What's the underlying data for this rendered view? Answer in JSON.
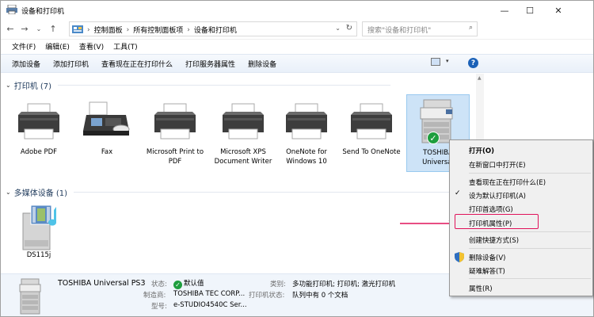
{
  "window": {
    "title": "设备和打印机",
    "minimize": "—",
    "maximize": "☐",
    "close": "✕"
  },
  "nav": {
    "back": "←",
    "forward": "→",
    "recent": "⌄",
    "up": "↑"
  },
  "address": {
    "crumbs": [
      "控制面板",
      "所有控制面板项",
      "设备和打印机"
    ],
    "separator": "›",
    "dropdown": "⌄",
    "refresh": "↻"
  },
  "search": {
    "placeholder": "搜索\"设备和打印机\"",
    "icon": "⌕"
  },
  "menu": [
    "文件(F)",
    "编辑(E)",
    "查看(V)",
    "工具(T)"
  ],
  "toolbar": {
    "commands": [
      "添加设备",
      "添加打印机",
      "查看现在正在打印什么",
      "打印服务器属性",
      "删除设备"
    ],
    "view_dropdown": "▾",
    "help": "?"
  },
  "groups": {
    "printers": {
      "title": "打印机 (7)",
      "chevron": "⌄"
    },
    "multimedia": {
      "title": "多媒体设备 (1)",
      "chevron": "⌄"
    }
  },
  "devices": {
    "printers": [
      {
        "name": "Adobe PDF"
      },
      {
        "name": "Fax"
      },
      {
        "name": "Microsoft Print to PDF"
      },
      {
        "name": "Microsoft XPS Document Writer"
      },
      {
        "name": "OneNote for Windows 10"
      },
      {
        "name": "Send To OneNote"
      },
      {
        "name": "TOSHIBA Universal"
      }
    ],
    "multimedia": [
      {
        "name": "DS115j"
      }
    ]
  },
  "details": {
    "name": "TOSHIBA Universal PS3",
    "status_label": "状态:",
    "status_value": "默认值",
    "manufacturer_label": "制造商:",
    "manufacturer_value": "TOSHIBA TEC CORP...",
    "model_label": "型号:",
    "model_value": "e-STUDIO4540C Ser...",
    "category_label": "类别:",
    "category_value": "多功能打印机; 打印机; 激光打印机",
    "printstatus_label": "打印机状态:",
    "printstatus_value": "队列中有 0 个文档"
  },
  "context_menu": {
    "open": "打开(O)",
    "open_new": "在新窗口中打开(E)",
    "see_printing": "查看现在正在打印什么(E)",
    "set_default": "设为默认打印机(A)",
    "preferences": "打印首选项(G)",
    "properties_printer": "打印机属性(P)",
    "shortcut": "创建快捷方式(S)",
    "remove": "删除设备(V)",
    "troubleshoot": "疑难解答(T)",
    "properties": "属性(R)",
    "check": "✓"
  },
  "colors": {
    "highlight": "#e0125a",
    "selection": "#cde3f7",
    "group_title": "#1e395b",
    "ok_green": "#1e9e3e"
  }
}
